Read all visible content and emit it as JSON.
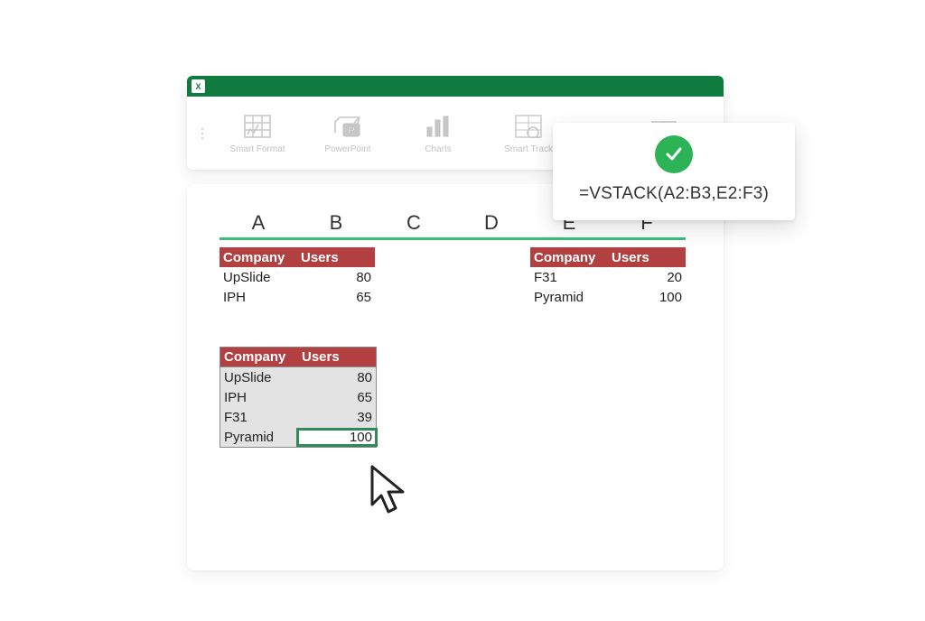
{
  "ribbon": {
    "excel_glyph": "X",
    "items": [
      {
        "label": "Smart Format"
      },
      {
        "label": "PowerPoint"
      },
      {
        "label": "Charts"
      },
      {
        "label": "Smart Track"
      },
      {
        "label": ""
      },
      {
        "label": ""
      }
    ]
  },
  "columns": [
    "A",
    "B",
    "C",
    "D",
    "E",
    "F"
  ],
  "header": {
    "company": "Company",
    "users": "Users"
  },
  "tableA": [
    {
      "company": "UpSlide",
      "users": 80
    },
    {
      "company": "IPH",
      "users": 65
    }
  ],
  "tableB": [
    {
      "company": "F31",
      "users": 20
    },
    {
      "company": "Pyramid",
      "users": 100
    }
  ],
  "result": [
    {
      "company": "UpSlide",
      "users": 80
    },
    {
      "company": "IPH",
      "users": 65
    },
    {
      "company": "F31",
      "users": 39
    },
    {
      "company": "Pyramid",
      "users": 100
    }
  ],
  "formula": "=VSTACK(A2:B3,E2:F3)"
}
